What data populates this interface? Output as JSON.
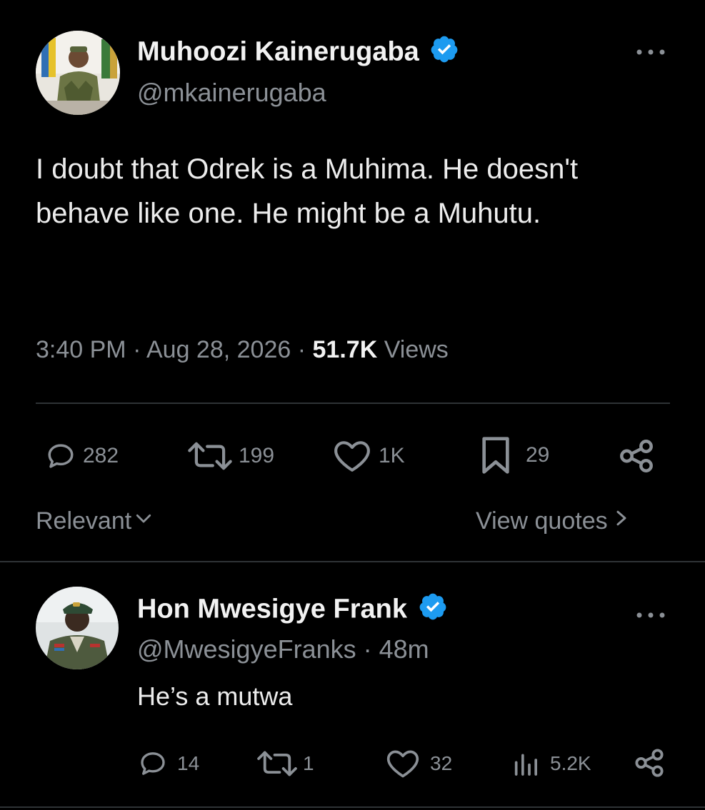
{
  "main_tweet": {
    "author_name": "Muhoozi Kainerugaba",
    "author_handle": "@mkainerugaba",
    "text": "I doubt that Odrek is a Muhima. He doesn't behave like one. He might be a Muhutu.",
    "time": "3:40 PM",
    "date": "Aug 28, 2026",
    "separator": "·",
    "views_count": "51.7K",
    "views_label": "Views",
    "replies": "282",
    "reposts": "199",
    "likes": "1K",
    "bookmarks": "29"
  },
  "sort": {
    "label": "Relevant",
    "view_quotes": "View quotes"
  },
  "reply": {
    "author_name": "Hon Mwesigye Frank",
    "author_handle": "@MwesigyeFranks",
    "age": "· 48m",
    "text": "He’s a mutwa",
    "replies": "14",
    "reposts": "1",
    "likes": "32",
    "views": "5.2K"
  },
  "icons": {
    "verified": "verified-badge-icon",
    "more": "more-options-icon",
    "reply": "reply-icon",
    "repost": "repost-icon",
    "like": "heart-icon",
    "bookmark": "bookmark-icon",
    "share": "share-icon",
    "views": "views-chart-icon",
    "chevron_down": "chevron-down-icon",
    "chevron_right": "chevron-right-icon"
  },
  "colors": {
    "background": "#000000",
    "verified_blue": "#1d9bf0",
    "text_primary": "#e7e9ea",
    "text_secondary": "#8b9096",
    "divider": "#2f3336"
  }
}
